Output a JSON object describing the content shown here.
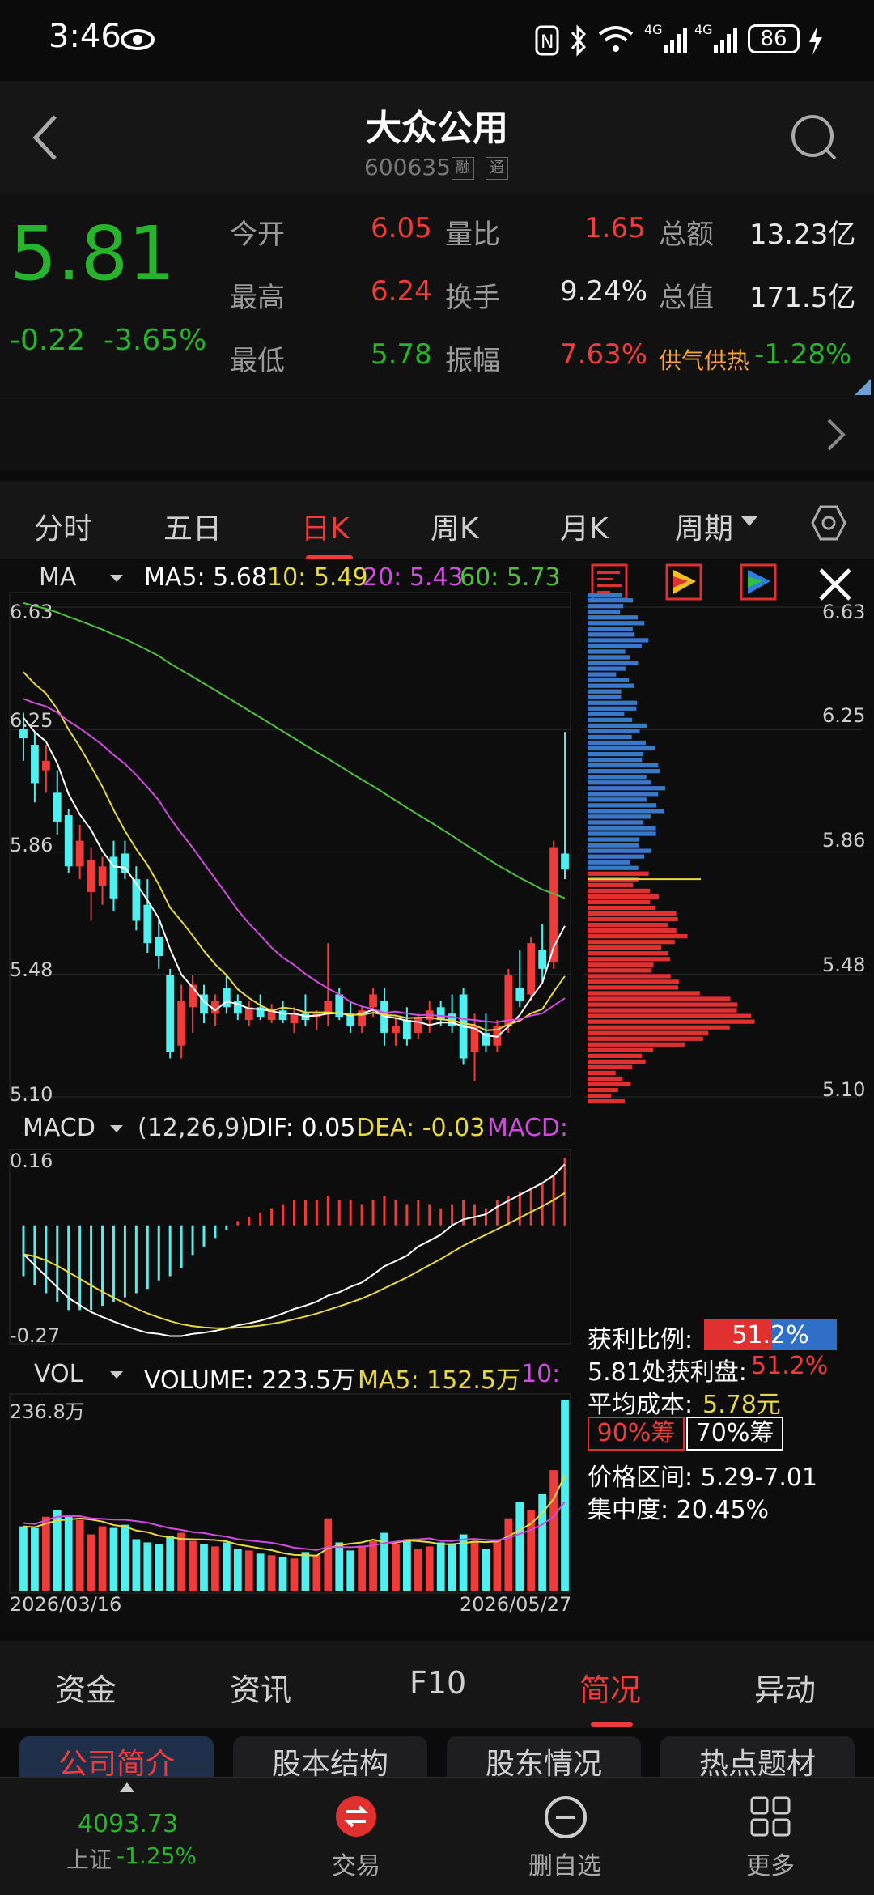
{
  "status_bar": {
    "time": "3:46",
    "battery": "86"
  },
  "header": {
    "title": "大众公用",
    "code": "600635",
    "tags": [
      "融",
      "通"
    ]
  },
  "quote": {
    "price": "5.81",
    "change": "-0.22",
    "change_pct": "-3.65%",
    "rows": [
      {
        "l1": "今开",
        "v1": "6.05",
        "l2": "量比",
        "v2": "1.65",
        "l3": "总额",
        "v3": "13.23亿"
      },
      {
        "l1": "最高",
        "v1": "6.24",
        "l2": "换手",
        "v2": "9.24%",
        "l3": "总值",
        "v3": "171.5亿"
      },
      {
        "l1": "最低",
        "v1": "5.78",
        "l2": "振幅",
        "v2": "7.63%",
        "l3": "供气供热",
        "v3": "-1.28%"
      }
    ]
  },
  "period_tabs": [
    "分时",
    "五日",
    "日K",
    "周K",
    "月K",
    "周期"
  ],
  "active_period": "日K",
  "ma": {
    "label": "MA",
    "ma5": "MA5: 5.68",
    "ma10": "10: 5.49",
    "ma20": "20: 5.43",
    "ma60": "60: 5.73"
  },
  "price_axis": [
    "6.63",
    "6.25",
    "5.86",
    "5.48",
    "5.10"
  ],
  "macd": {
    "label": "MACD",
    "params": "(12,26,9)",
    "dif": "DIF: 0.05",
    "dea": "DEA: -0.03",
    "macd": "MACD:",
    "top": "0.16",
    "bottom": "-0.27"
  },
  "vol": {
    "label": "VOL",
    "volume": "VOLUME: 223.5万",
    "ma5": "MA5: 152.5万",
    "ma10": "10:",
    "top": "236.8万",
    "date_start": "2026/03/16",
    "date_end": "2026/05/27"
  },
  "chips": {
    "profit_label": "获利比例:",
    "profit_value": "51.2%",
    "profit_ratio": 0.512,
    "line2_label": "5.81处获利盘:",
    "line2_value": "51.2%",
    "avg_label": "平均成本:",
    "avg_value": "5.78元",
    "btn90": "90%筹",
    "btn70": "70%筹",
    "range": "价格区间: 5.29-7.01",
    "concentration": "集中度: 20.45%"
  },
  "bottom_tabs": [
    "资金",
    "资讯",
    "F10",
    "简况",
    "异动"
  ],
  "active_bottom_tab": "简况",
  "sub_tabs": [
    "公司简介",
    "股本结构",
    "股东情况",
    "热点题材"
  ],
  "nav": {
    "index_value": "4093.73",
    "index_name": "上证",
    "index_change": "-1.25%",
    "trade": "交易",
    "remove": "删自选",
    "more": "更多"
  },
  "colors": {
    "up": "#f03b3b",
    "down": "#4ff0f0",
    "ma5": "#ffffff",
    "ma10": "#e8d93a",
    "ma20": "#d24be0",
    "ma60": "#4fbf3d"
  },
  "chart_data": {
    "type": "candlestick",
    "ylim": [
      5.1,
      6.63
    ],
    "candles": [
      {
        "o": 6.25,
        "h": 6.3,
        "l": 6.15,
        "c": 6.22
      },
      {
        "o": 6.2,
        "h": 6.24,
        "l": 6.02,
        "c": 6.08
      },
      {
        "o": 6.12,
        "h": 6.2,
        "l": 6.05,
        "c": 6.15
      },
      {
        "o": 6.05,
        "h": 6.12,
        "l": 5.92,
        "c": 5.96
      },
      {
        "o": 5.98,
        "h": 6.0,
        "l": 5.8,
        "c": 5.82
      },
      {
        "o": 5.82,
        "h": 5.95,
        "l": 5.78,
        "c": 5.9
      },
      {
        "o": 5.74,
        "h": 5.88,
        "l": 5.65,
        "c": 5.84
      },
      {
        "o": 5.76,
        "h": 5.85,
        "l": 5.7,
        "c": 5.82
      },
      {
        "o": 5.85,
        "h": 5.9,
        "l": 5.68,
        "c": 5.72
      },
      {
        "o": 5.86,
        "h": 5.9,
        "l": 5.78,
        "c": 5.8
      },
      {
        "o": 5.78,
        "h": 5.82,
        "l": 5.62,
        "c": 5.65
      },
      {
        "o": 5.7,
        "h": 5.78,
        "l": 5.55,
        "c": 5.58
      },
      {
        "o": 5.6,
        "h": 5.66,
        "l": 5.5,
        "c": 5.54
      },
      {
        "o": 5.48,
        "h": 5.5,
        "l": 5.22,
        "c": 5.24
      },
      {
        "o": 5.26,
        "h": 5.45,
        "l": 5.22,
        "c": 5.4
      },
      {
        "o": 5.38,
        "h": 5.48,
        "l": 5.3,
        "c": 5.45
      },
      {
        "o": 5.42,
        "h": 5.45,
        "l": 5.33,
        "c": 5.36
      },
      {
        "o": 5.36,
        "h": 5.42,
        "l": 5.32,
        "c": 5.4
      },
      {
        "o": 5.44,
        "h": 5.48,
        "l": 5.36,
        "c": 5.38
      },
      {
        "o": 5.4,
        "h": 5.42,
        "l": 5.34,
        "c": 5.36
      },
      {
        "o": 5.34,
        "h": 5.4,
        "l": 5.32,
        "c": 5.38
      },
      {
        "o": 5.38,
        "h": 5.42,
        "l": 5.34,
        "c": 5.35
      },
      {
        "o": 5.34,
        "h": 5.39,
        "l": 5.33,
        "c": 5.37
      },
      {
        "o": 5.37,
        "h": 5.4,
        "l": 5.33,
        "c": 5.34
      },
      {
        "o": 5.33,
        "h": 5.38,
        "l": 5.3,
        "c": 5.36
      },
      {
        "o": 5.36,
        "h": 5.42,
        "l": 5.32,
        "c": 5.34
      },
      {
        "o": 5.35,
        "h": 5.37,
        "l": 5.31,
        "c": 5.36
      },
      {
        "o": 5.36,
        "h": 5.58,
        "l": 5.32,
        "c": 5.4
      },
      {
        "o": 5.42,
        "h": 5.44,
        "l": 5.34,
        "c": 5.35
      },
      {
        "o": 5.36,
        "h": 5.4,
        "l": 5.3,
        "c": 5.32
      },
      {
        "o": 5.32,
        "h": 5.38,
        "l": 5.3,
        "c": 5.37
      },
      {
        "o": 5.38,
        "h": 5.44,
        "l": 5.35,
        "c": 5.42
      },
      {
        "o": 5.4,
        "h": 5.44,
        "l": 5.26,
        "c": 5.3
      },
      {
        "o": 5.3,
        "h": 5.35,
        "l": 5.26,
        "c": 5.32
      },
      {
        "o": 5.34,
        "h": 5.38,
        "l": 5.26,
        "c": 5.28
      },
      {
        "o": 5.3,
        "h": 5.36,
        "l": 5.28,
        "c": 5.35
      },
      {
        "o": 5.34,
        "h": 5.4,
        "l": 5.3,
        "c": 5.37
      },
      {
        "o": 5.38,
        "h": 5.4,
        "l": 5.32,
        "c": 5.34
      },
      {
        "o": 5.36,
        "h": 5.42,
        "l": 5.3,
        "c": 5.32
      },
      {
        "o": 5.42,
        "h": 5.44,
        "l": 5.2,
        "c": 5.22
      },
      {
        "o": 5.24,
        "h": 5.36,
        "l": 5.15,
        "c": 5.32
      },
      {
        "o": 5.3,
        "h": 5.36,
        "l": 5.24,
        "c": 5.26
      },
      {
        "o": 5.26,
        "h": 5.34,
        "l": 5.24,
        "c": 5.32
      },
      {
        "o": 5.32,
        "h": 5.5,
        "l": 5.3,
        "c": 5.48
      },
      {
        "o": 5.44,
        "h": 5.56,
        "l": 5.38,
        "c": 5.4
      },
      {
        "o": 5.42,
        "h": 5.6,
        "l": 5.4,
        "c": 5.58
      },
      {
        "o": 5.56,
        "h": 5.64,
        "l": 5.46,
        "c": 5.5
      },
      {
        "o": 5.52,
        "h": 5.9,
        "l": 5.5,
        "c": 5.88
      },
      {
        "o": 5.86,
        "h": 6.24,
        "l": 5.78,
        "c": 5.81
      }
    ],
    "volume": [
      80,
      78,
      92,
      100,
      92,
      88,
      70,
      80,
      78,
      82,
      64,
      60,
      58,
      68,
      72,
      62,
      58,
      55,
      60,
      52,
      50,
      46,
      44,
      42,
      40,
      48,
      44,
      90,
      60,
      50,
      56,
      62,
      72,
      58,
      64,
      52,
      55,
      60,
      58,
      70,
      62,
      52,
      64,
      90,
      110,
      100,
      120,
      150,
      236.8
    ],
    "macd_hist": [
      -0.12,
      -0.14,
      -0.16,
      -0.18,
      -0.2,
      -0.2,
      -0.2,
      -0.19,
      -0.18,
      -0.17,
      -0.16,
      -0.15,
      -0.13,
      -0.12,
      -0.1,
      -0.07,
      -0.05,
      -0.03,
      -0.01,
      0.01,
      0.02,
      0.03,
      0.04,
      0.05,
      0.06,
      0.06,
      0.06,
      0.07,
      0.06,
      0.06,
      0.05,
      0.06,
      0.07,
      0.06,
      0.05,
      0.06,
      0.05,
      0.04,
      0.05,
      0.06,
      0.05,
      0.04,
      0.06,
      0.07,
      0.08,
      0.09,
      0.1,
      0.12,
      0.16
    ],
    "chip_profit": 0.512
  }
}
